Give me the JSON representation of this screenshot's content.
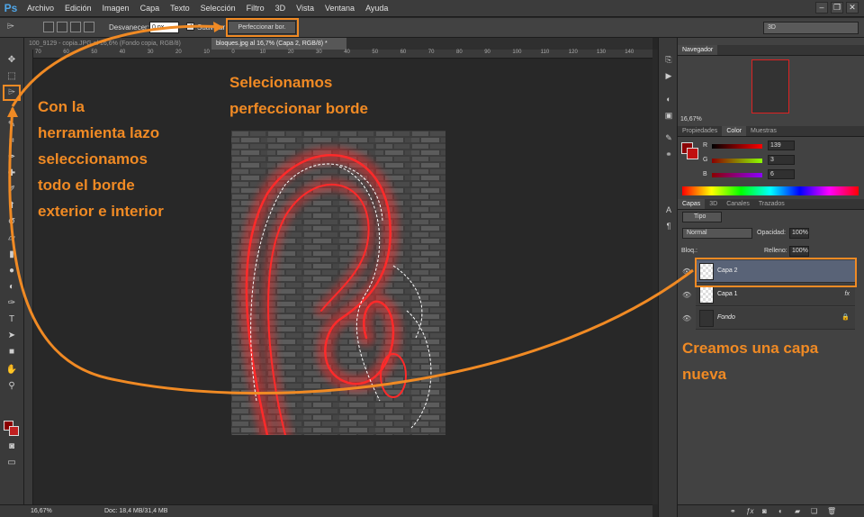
{
  "app": {
    "logo": "Ps",
    "accent": "#f08a24"
  },
  "menubar": {
    "items": [
      "Archivo",
      "Edición",
      "Imagen",
      "Capa",
      "Texto",
      "Selección",
      "Filtro",
      "3D",
      "Vista",
      "Ventana",
      "Ayuda"
    ]
  },
  "options_bar": {
    "desvanecer_label": "Desvanecer:",
    "desvanecer_value": "0 px",
    "suavizar_label": "Suavizar",
    "suavizar_checked": "✓",
    "refine_edge_button": "Perfeccionar bor.",
    "workspace_select": "3D"
  },
  "tabs": [
    {
      "label": "100_9129 - copia.JPG al 16,6% (Fondo copia, RGB/8)"
    },
    {
      "label": "bloques.jpg al 16,7% (Capa 2, RGB/8) *"
    }
  ],
  "ruler_ticks": [
    "70",
    "60",
    "50",
    "40",
    "30",
    "20",
    "10",
    "0",
    "10",
    "20",
    "30",
    "40",
    "50",
    "60",
    "70",
    "80",
    "90",
    "100",
    "110",
    "120",
    "130",
    "140"
  ],
  "status": {
    "zoom": "16,67%",
    "doc": "Doc: 18,4 MB/31,4 MB"
  },
  "annotations": {
    "left_text": [
      "Con la",
      "herramienta lazo",
      "seleccionamos",
      "todo el borde",
      "exterior e interior"
    ],
    "top_text": [
      "Selecionamos",
      "perfeccionar borde"
    ],
    "right_text": [
      "Creamos una capa",
      "nueva"
    ]
  },
  "navigator": {
    "title": "Navegador",
    "zoom": "16,67%"
  },
  "color_panel": {
    "tabs": [
      "Propiedades",
      "Color",
      "Muestras"
    ],
    "r_label": "R",
    "r_value": "139",
    "g_label": "G",
    "g_value": "3",
    "b_label": "B",
    "b_value": "6",
    "fg": "#8b0306"
  },
  "layers_panel": {
    "tabs": [
      "Capas",
      "3D",
      "Canales",
      "Trazados"
    ],
    "filter_label": "Tipo",
    "blend_mode": "Normal",
    "opacity_label": "Opacidad:",
    "opacity_value": "100%",
    "lock_label": "Bloq.:",
    "fill_label": "Relleno:",
    "fill_value": "100%",
    "layers": [
      {
        "name": "Capa 2",
        "selected": true
      },
      {
        "name": "Capa 1",
        "fx": "fx"
      },
      {
        "name": "Fondo",
        "lock": "🔒"
      }
    ]
  }
}
